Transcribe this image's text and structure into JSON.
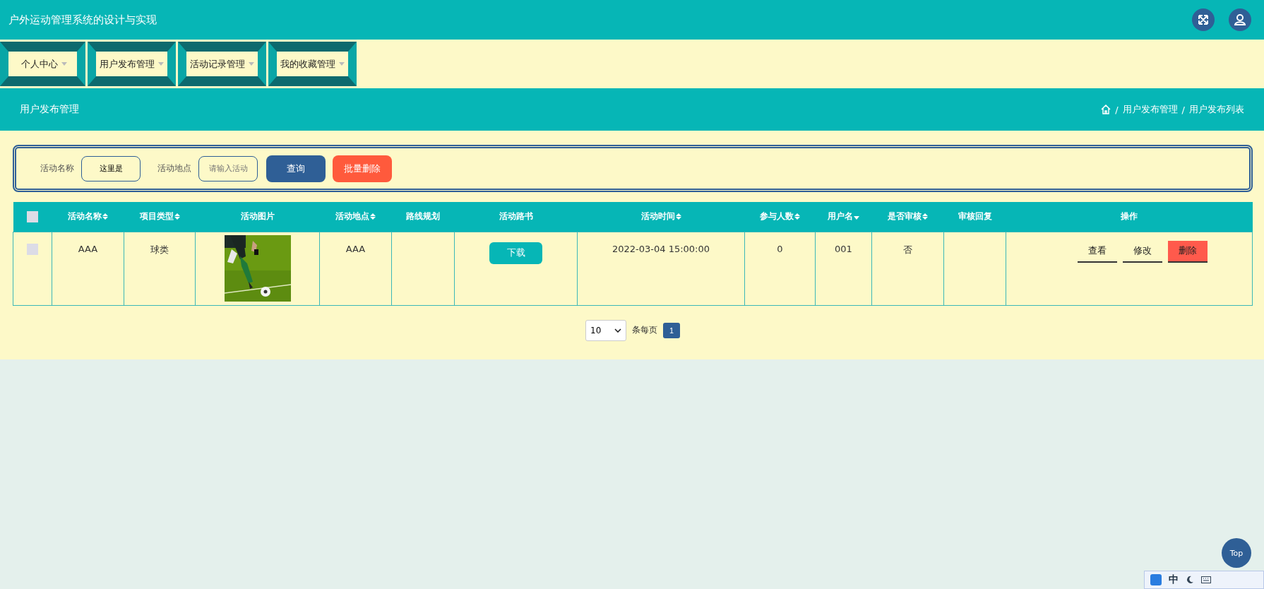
{
  "header": {
    "title": "户外运动管理系统的设计与实现"
  },
  "menu": [
    {
      "label": "个人中心"
    },
    {
      "label": "用户发布管理"
    },
    {
      "label": "活动记录管理"
    },
    {
      "label": "我的收藏管理"
    }
  ],
  "page_title": "用户发布管理",
  "breadcrumb": [
    {
      "separator": "/",
      "label": "用户发布管理"
    },
    {
      "separator": "/",
      "label": "用户发布列表"
    }
  ],
  "search": {
    "fields": [
      {
        "label": "活动名称",
        "value": "这里是"
      },
      {
        "label": "活动地点",
        "placeholder": "请输入活动"
      }
    ],
    "query_button": "查询",
    "batch_delete_button": "批量删除"
  },
  "table": {
    "select_all": {
      "checked": false
    },
    "columns": [
      {
        "label": "活动名称",
        "sortable": true,
        "sorted_desc": false
      },
      {
        "label": "项目类型",
        "sortable": true,
        "sorted_desc": false
      },
      {
        "label": "活动图片",
        "sortable": false,
        "sorted_desc": false
      },
      {
        "label": "活动地点",
        "sortable": true,
        "sorted_desc": false
      },
      {
        "label": "路线规划",
        "sortable": false,
        "sorted_desc": false
      },
      {
        "label": "活动路书",
        "sortable": false,
        "sorted_desc": false
      },
      {
        "label": "活动时间",
        "sortable": true,
        "sorted_desc": false
      },
      {
        "label": "参与人数",
        "sortable": true,
        "sorted_desc": false
      },
      {
        "label": "用户名",
        "sortable": true,
        "sorted_desc": true
      },
      {
        "label": "是否审核",
        "sortable": true,
        "sorted_desc": false
      },
      {
        "label": "审核回复",
        "sortable": false,
        "sorted_desc": false
      },
      {
        "label": "操作",
        "sortable": false,
        "sorted_desc": false
      }
    ],
    "rows": [
      {
        "checked": false,
        "name": "AAA",
        "type": "球类",
        "location": "AAA",
        "route": "",
        "download": "下载",
        "time": "2022-03-04 15:00:00",
        "participants": "0",
        "username": "001",
        "reviewed": "否",
        "reply": "",
        "actions": {
          "view": "查看",
          "edit": "修改",
          "delete": "删除"
        }
      }
    ]
  },
  "pagination": {
    "page_size": "10",
    "per_page_label": "条每页",
    "pages": [
      {
        "label": "1",
        "selected": true
      }
    ]
  },
  "back_to_top": "Top",
  "ime_bar": {
    "mode": "中"
  }
}
